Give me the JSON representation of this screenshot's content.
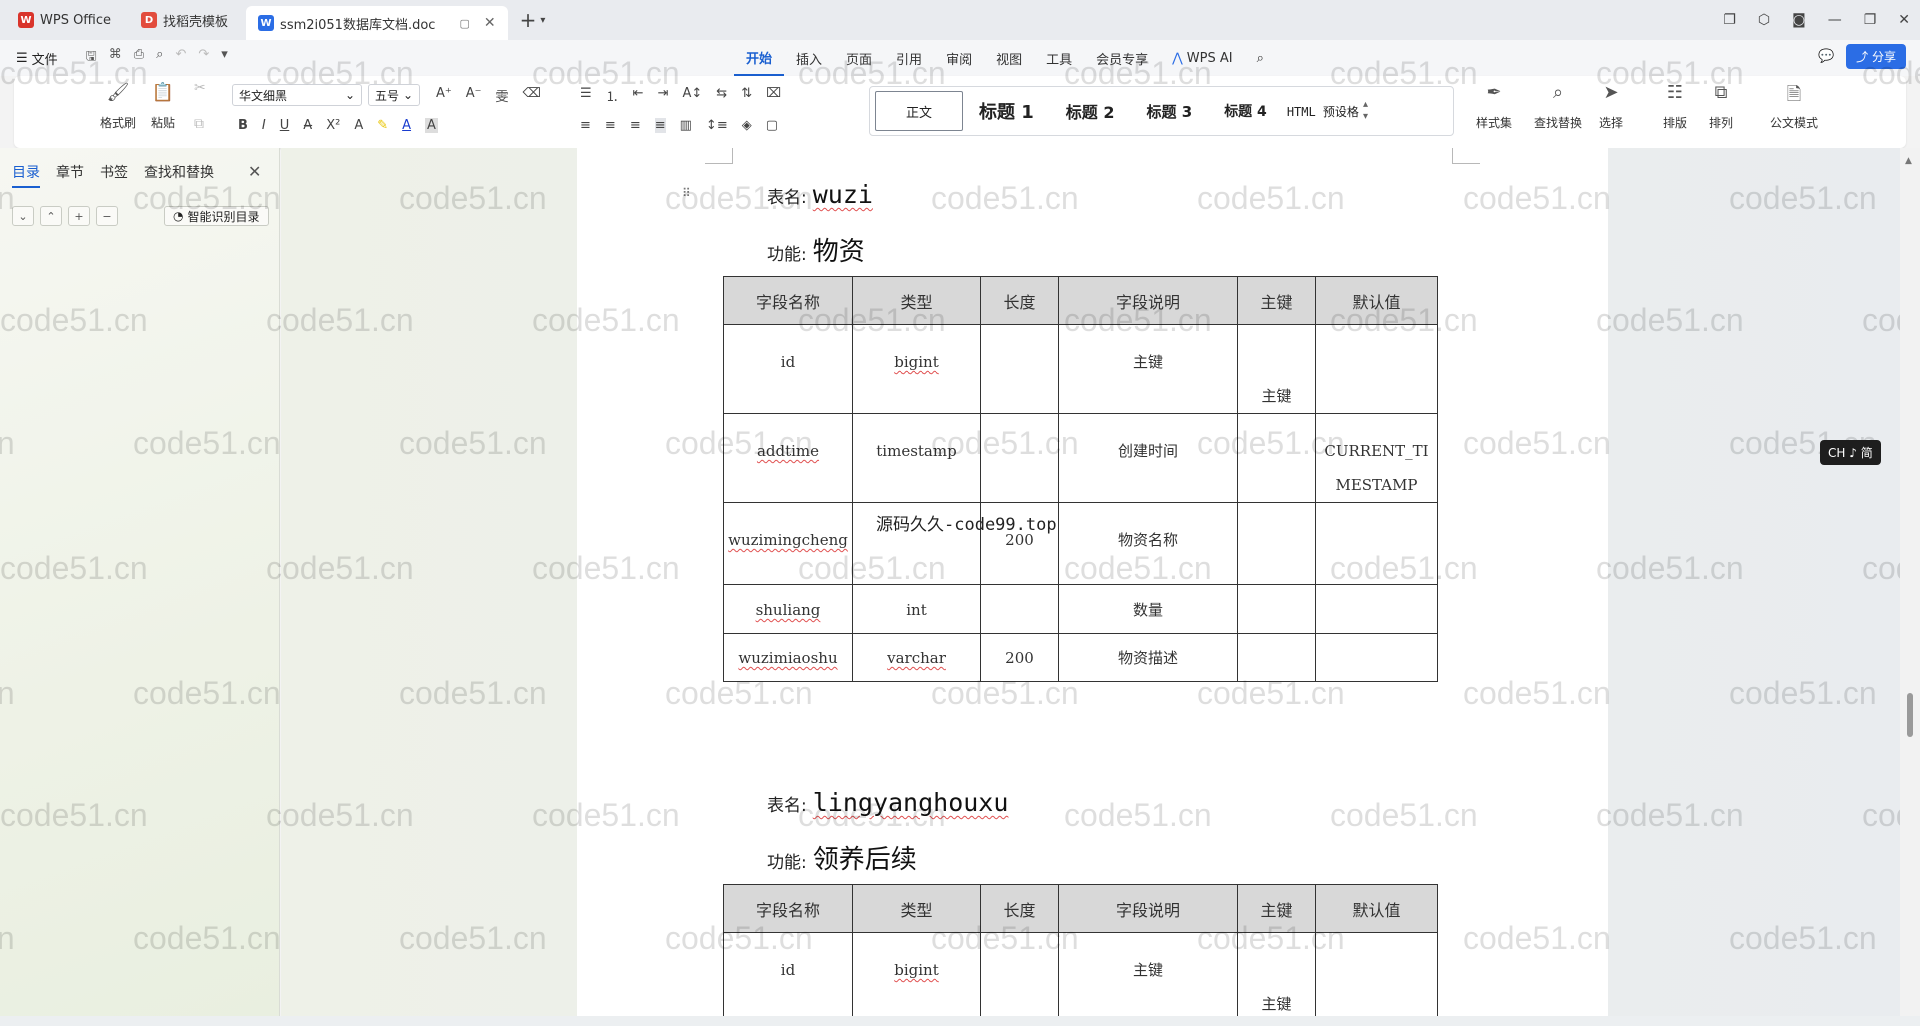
{
  "tabs": [
    {
      "label": "WPS Office",
      "icon": "wps-logo-icon",
      "color": "#d9342b"
    },
    {
      "label": "找稻壳模板",
      "icon": "docer-logo-icon",
      "color": "#e24c3d"
    },
    {
      "label": "ssm2i051数据库文档.doc",
      "icon": "word-doc-icon",
      "color": "#2b6de5"
    }
  ],
  "menu": {
    "file": "文件",
    "items": [
      "开始",
      "插入",
      "页面",
      "引用",
      "审阅",
      "视图",
      "工具",
      "会员专享"
    ],
    "active": "开始",
    "ai": "WPS AI",
    "share": "分享"
  },
  "ribbon": {
    "format_painter": "格式刷",
    "paste": "粘贴",
    "font_name": "华文细黑",
    "font_size": "五号",
    "styles": [
      "正文",
      "标题 1",
      "标题 2",
      "标题 3",
      "标题 4",
      "HTML 预设格"
    ],
    "style_set": "样式集",
    "find_replace": "查找替换",
    "select": "选择",
    "layout": "排版",
    "arrange": "排列",
    "official": "公文模式"
  },
  "nav": {
    "tabs": [
      "目录",
      "章节",
      "书签",
      "查找和替换"
    ],
    "active": "目录",
    "smart_btn": "智能识别目录"
  },
  "doc": {
    "label_table": "表名:",
    "label_func": "功能:",
    "table1": {
      "name": "wuzi",
      "func": "物资",
      "headers": [
        "字段名称",
        "类型",
        "长度",
        "字段说明",
        "主键",
        "默认值"
      ],
      "rows": [
        [
          "id",
          "bigint",
          "",
          "主键",
          "主键",
          ""
        ],
        [
          "addtime",
          "timestamp",
          "",
          "创建时间",
          "",
          "CURRENT_TIMESTAMP"
        ],
        [
          "wuzimingcheng",
          "",
          "200",
          "物资名称",
          "",
          ""
        ],
        [
          "shuliang",
          "int",
          "",
          "数量",
          "",
          ""
        ],
        [
          "wuzimiaoshu",
          "varchar",
          "200",
          "物资描述",
          "",
          ""
        ]
      ]
    },
    "table2": {
      "name": "lingyanghouxu",
      "func": "领养后续",
      "headers": [
        "字段名称",
        "类型",
        "长度",
        "字段说明",
        "主键",
        "默认值"
      ],
      "rows": [
        [
          "id",
          "bigint",
          "",
          "主键",
          "主键",
          ""
        ]
      ]
    },
    "overlay_source": "源码久久-code99.top"
  },
  "watermark": "code51.cn",
  "ime": "CH ♪ 简"
}
